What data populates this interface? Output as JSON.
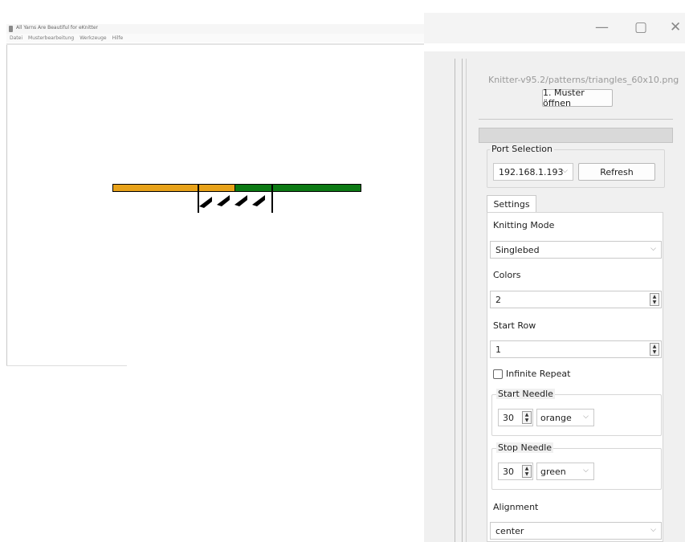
{
  "small_window": {
    "title": "All Yarns Are Beautiful for eKnitter",
    "menu": [
      "Datei",
      "Musterbearbeitung",
      "Werkzeuge",
      "Hilfe"
    ]
  },
  "pattern_colors": {
    "orange": "#e8a21a",
    "green": "#0c7a14",
    "marker": "#000000"
  },
  "big_window": {
    "minimize_glyph": "—",
    "restore_glyph": "▢",
    "close_glyph": "✕"
  },
  "panel": {
    "file_path": "Knitter-v95.2/patterns/triangles_60x10.png",
    "open_button": "1. Muster öffnen",
    "port_selection": {
      "title": "Port Selection",
      "selected_port": "192.168.1.193",
      "refresh_button": "Refresh"
    },
    "tabs": [
      {
        "label": "Settings"
      }
    ],
    "settings": {
      "knitting_mode_label": "Knitting Mode",
      "knitting_mode_value": "Singlebed",
      "colors_label": "Colors",
      "colors_value": "2",
      "start_row_label": "Start Row",
      "start_row_value": "1",
      "infinite_repeat_label": "Infinite Repeat",
      "infinite_repeat_checked": false,
      "start_needle": {
        "title": "Start Needle",
        "value": "30",
        "color": "orange"
      },
      "stop_needle": {
        "title": "Stop Needle",
        "value": "30",
        "color": "green"
      },
      "alignment_label": "Alignment",
      "alignment_value": "center"
    }
  }
}
